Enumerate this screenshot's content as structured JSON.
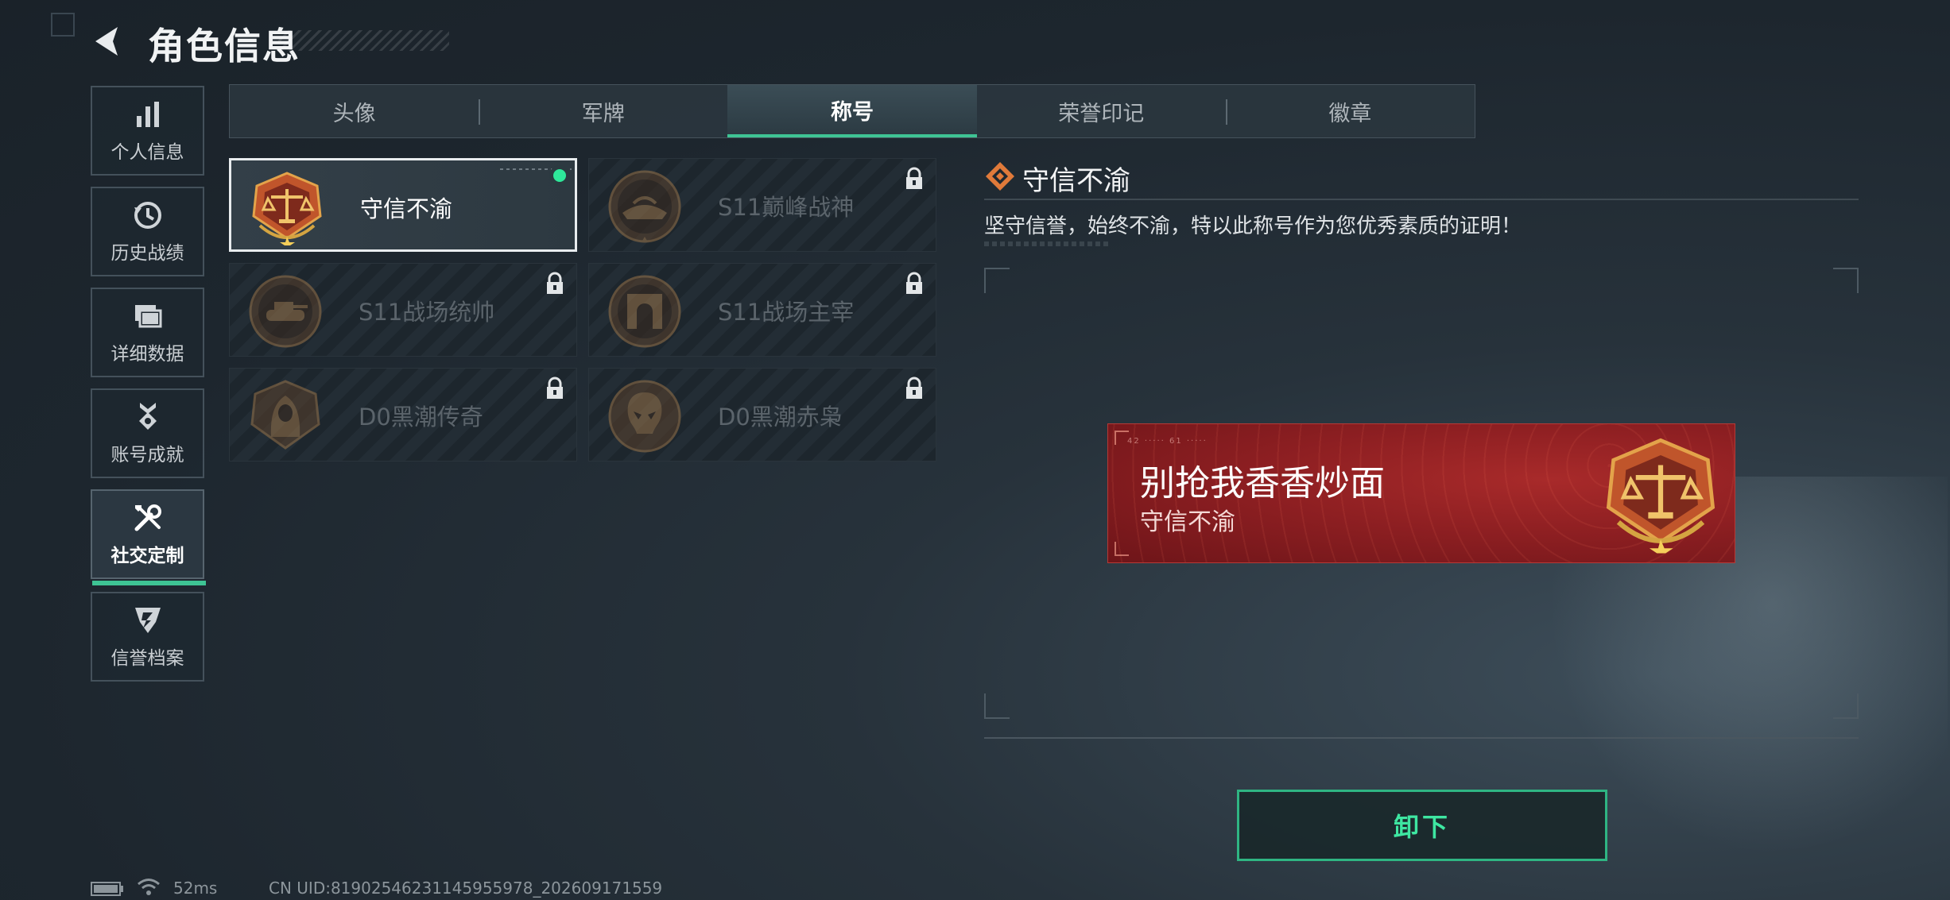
{
  "header": {
    "title": "角色信息"
  },
  "side_nav": {
    "items": [
      {
        "label": "个人信息",
        "icon": "bar-chart-icon"
      },
      {
        "label": "历史战绩",
        "icon": "history-clock-icon"
      },
      {
        "label": "详细数据",
        "icon": "folder-icon"
      },
      {
        "label": "账号成就",
        "icon": "medal-icon"
      },
      {
        "label": "社交定制",
        "icon": "tools-icon",
        "active": true
      },
      {
        "label": "信誉档案",
        "icon": "shield-icon"
      }
    ]
  },
  "tabs": {
    "items": [
      {
        "label": "头像"
      },
      {
        "label": "军牌"
      },
      {
        "label": "称号",
        "active": true
      },
      {
        "label": "荣誉印记"
      },
      {
        "label": "徽章"
      }
    ]
  },
  "titles": {
    "items": [
      {
        "label": "守信不渝",
        "icon": "scales-medal-icon",
        "selected": true,
        "equipped": true,
        "locked": false
      },
      {
        "label": "S11巅峰战神",
        "icon": "hovercraft-medal-icon",
        "locked": true
      },
      {
        "label": "S11战场统帅",
        "icon": "tank-medal-icon",
        "locked": true
      },
      {
        "label": "S11战场主宰",
        "icon": "arch-medal-icon",
        "locked": true
      },
      {
        "label": "D0黑潮传奇",
        "icon": "hooded-figure-medal-icon",
        "locked": true
      },
      {
        "label": "D0黑潮赤枭",
        "icon": "skull-medal-icon",
        "locked": true
      }
    ]
  },
  "detail": {
    "title": "守信不渝",
    "description": "坚守信誉，始终不渝，特以此称号作为您优秀素质的证明！",
    "nameplate": {
      "player_name": "别抢我香香炒面",
      "title": "守信不渝",
      "small_text": "42 ····· 61 ·····"
    },
    "unequip_label": "卸下"
  },
  "status_bar": {
    "ping": "52ms",
    "uid": "CN UID:81902546231145955978_202609171559"
  },
  "colors": {
    "accent": "#3ec494",
    "equipped_dot": "#2ee89a",
    "nameplate_red": "#8e1f22"
  }
}
